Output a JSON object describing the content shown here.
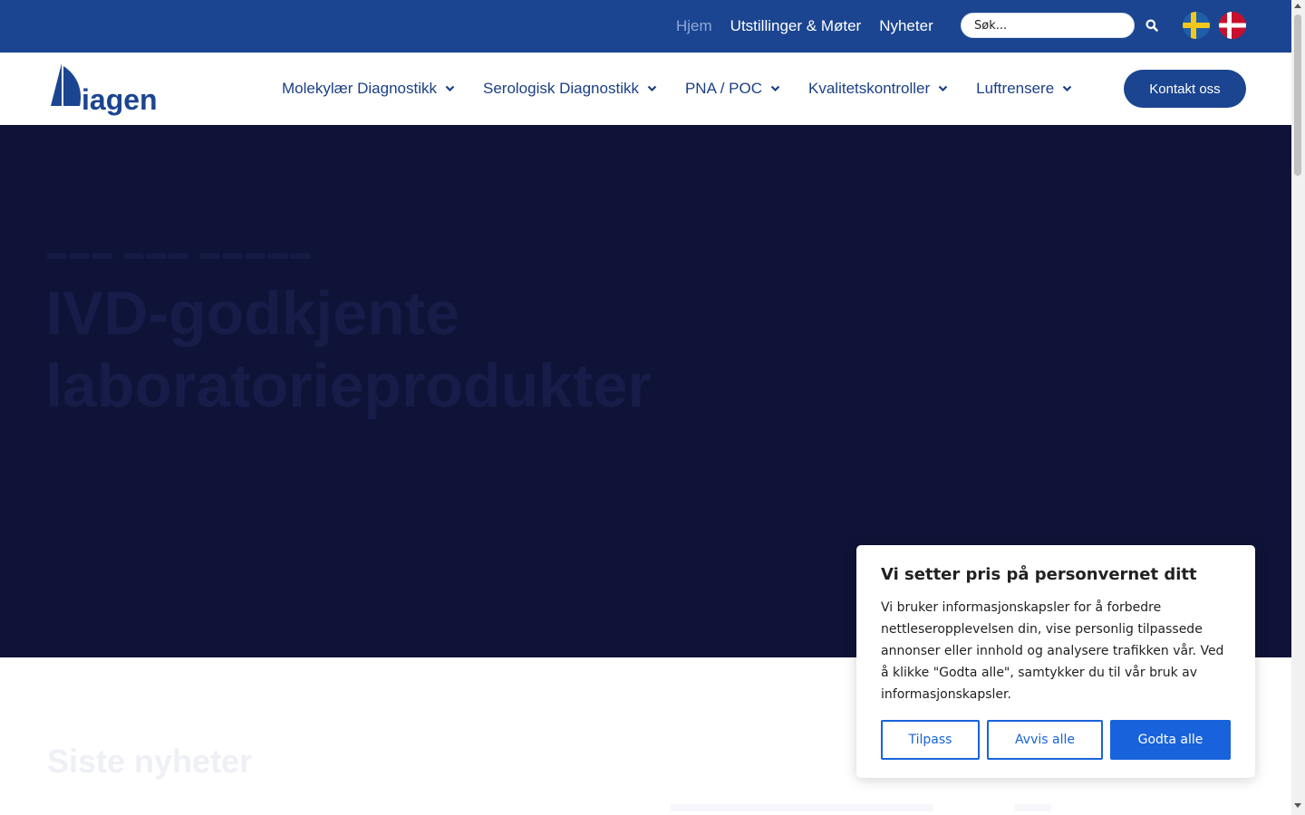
{
  "top_nav": {
    "items": [
      {
        "label": "Hjem",
        "active": true
      },
      {
        "label": "Utstillinger & Møter",
        "active": false
      },
      {
        "label": "Nyheter",
        "active": false
      }
    ],
    "search_placeholder": "Søk..."
  },
  "flags": [
    {
      "icon": "sweden-flag-icon"
    },
    {
      "icon": "denmark-flag-icon"
    }
  ],
  "logo": {
    "text": "Diagen"
  },
  "main_nav": {
    "items": [
      {
        "label": "Molekylær Diagnostikk"
      },
      {
        "label": "Serologisk Diagnostikk"
      },
      {
        "label": "PNA / POC"
      },
      {
        "label": "Kvalitetskontroller"
      },
      {
        "label": "Luftrensere"
      }
    ],
    "contact_label": "Kontakt oss"
  },
  "hero": {
    "title": "IVD-godkjente laboratorieprodukter"
  },
  "news": {
    "title": "Siste nyheter"
  },
  "cookie": {
    "title": "Vi setter pris på personvernet ditt",
    "text": "Vi bruker informasjonskapsler for å forbedre nettleseropplevelsen din, vise personlig tilpassede annonser eller innhold og analysere trafikken vår. Ved å klikke \"Godta alle\", samtykker du til vår bruk av informasjonskapsler.",
    "customize_label": "Tilpass",
    "reject_label": "Avvis alle",
    "accept_label": "Godta alle"
  },
  "colors": {
    "brand_blue": "#1b4590",
    "hero_navy": "#0f1337",
    "cookie_accent": "#1863dc"
  }
}
